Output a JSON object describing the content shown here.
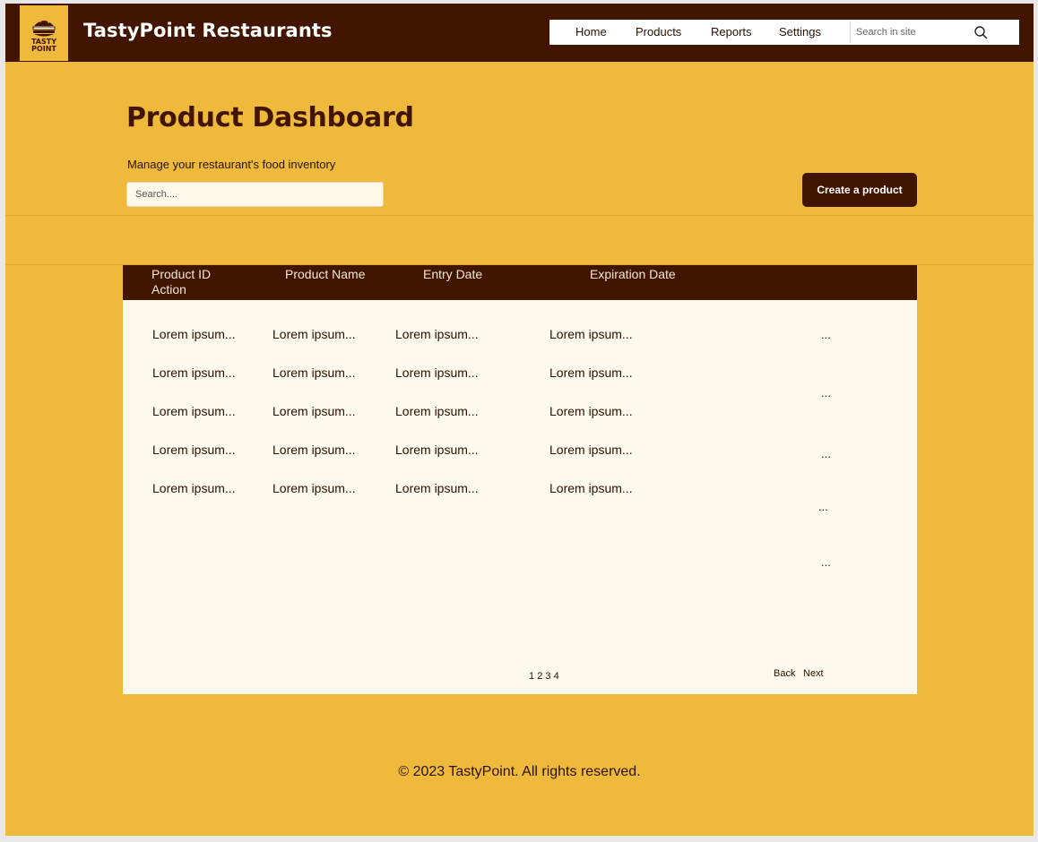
{
  "header": {
    "logo_text_line1": "TASTY",
    "logo_text_line2": "POINT",
    "brand": "TastyPoint Restaurants",
    "nav": [
      "Home",
      "Products",
      "Reports",
      "Settings"
    ],
    "search_placeholder": "Search in site",
    "search_icon": "search-icon"
  },
  "hero": {
    "title": "Product Dashboard",
    "subtitle": "Manage your restaurant's food inventory",
    "search_placeholder": "Search....",
    "create_label": "Create a product"
  },
  "table": {
    "headers": {
      "id": "Product ID",
      "action": "Action",
      "name": "Product Name",
      "entry": "Entry Date",
      "expiration": "Expiration Date"
    },
    "rows": [
      [
        "Lorem ipsum...",
        "Lorem ipsum...",
        "Lorem ipsum...",
        "Lorem ipsum..."
      ],
      [
        "Lorem ipsum...",
        "Lorem ipsum...",
        "Lorem ipsum...",
        "Lorem ipsum..."
      ],
      [
        "Lorem ipsum...",
        "Lorem ipsum...",
        "Lorem ipsum...",
        "Lorem ipsum..."
      ],
      [
        "Lorem ipsum...",
        "Lorem ipsum...",
        "Lorem ipsum...",
        "Lorem ipsum..."
      ],
      [
        "Lorem ipsum...",
        "Lorem ipsum...",
        "Lorem ipsum...",
        "Lorem ipsum..."
      ]
    ],
    "action_menus": [
      "...",
      "...",
      "...",
      "...",
      "..."
    ],
    "pages": [
      "1",
      "2",
      "3",
      "4"
    ],
    "back_label": "Back",
    "next_label": "Next"
  },
  "footer": {
    "text": "© 2023 TastyPoint. All rights reserved."
  },
  "colors": {
    "brand_dark": "#421500",
    "brand_yellow": "#efba3c",
    "card_bg": "#fdf9ec"
  }
}
